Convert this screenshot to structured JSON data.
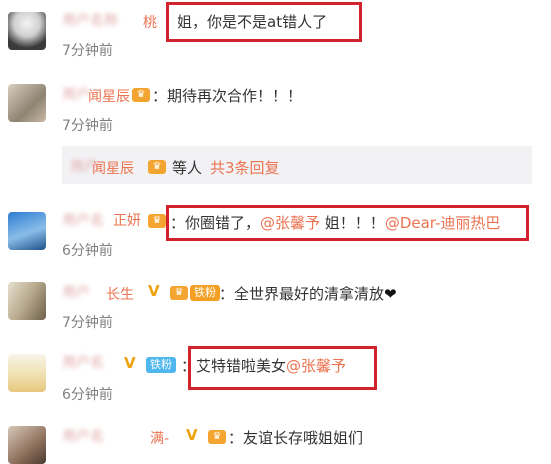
{
  "comments": [
    {
      "name": "桃",
      "text": "姐，你是不是at错人了",
      "time": "7分钟前"
    },
    {
      "name": "闻星辰",
      "text": "：期待再次合作！！！",
      "time": "7分钟前"
    },
    {
      "sub": {
        "name": "闻星辰",
        "text": "等人",
        "link": "共3条回复"
      }
    },
    {
      "name": "正妍",
      "text_pre": "：你圈错了，",
      "mention1": "@张馨予",
      "text_mid": " 姐！！！",
      "mention2": "@Dear-迪丽热巴",
      "time": "6分钟前"
    },
    {
      "name": "长生",
      "badge": "铁粉",
      "text": "：全世界最好的清拿清放",
      "heart": "❤",
      "time": "7分钟前"
    },
    {
      "name": "",
      "badge": "铁粉",
      "text_pre": "：艾特错啦美女",
      "mention": "@张馨予",
      "time": "6分钟前"
    },
    {
      "name": "满-",
      "text": "：友谊长存哦姐姐们"
    }
  ],
  "colors": {
    "accent": "#eb7350",
    "highlight_box": "#d0232d",
    "time": "#808080"
  }
}
